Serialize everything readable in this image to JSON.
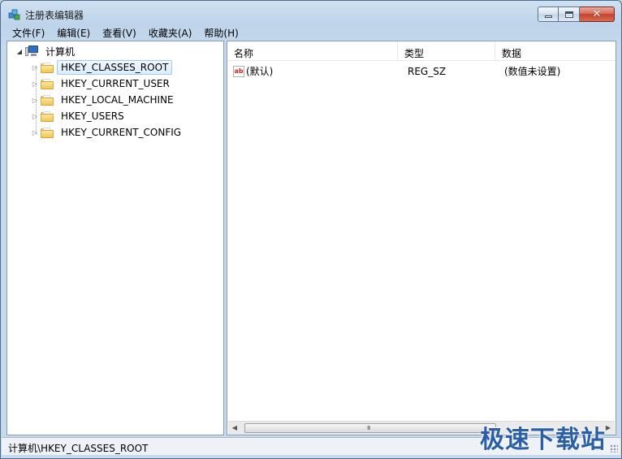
{
  "window": {
    "title": "注册表编辑器"
  },
  "menu": [
    "文件(F)",
    "编辑(E)",
    "查看(V)",
    "收藏夹(A)",
    "帮助(H)"
  ],
  "tree": {
    "root": "计算机",
    "keys": [
      "HKEY_CLASSES_ROOT",
      "HKEY_CURRENT_USER",
      "HKEY_LOCAL_MACHINE",
      "HKEY_USERS",
      "HKEY_CURRENT_CONFIG"
    ],
    "selected": "HKEY_CLASSES_ROOT"
  },
  "list": {
    "columns": [
      "名称",
      "类型",
      "数据"
    ],
    "rows": [
      {
        "name": "(默认)",
        "type": "REG_SZ",
        "data": "(数值未设置)"
      }
    ]
  },
  "scrollbar": {
    "grip": "III"
  },
  "status": {
    "path": "计算机\\HKEY_CLASSES_ROOT"
  },
  "watermark": "极速下载站",
  "icons": {
    "app": "regedit-icon",
    "computer": "computer-icon",
    "folder": "folder-icon",
    "value": "string-value-icon"
  }
}
